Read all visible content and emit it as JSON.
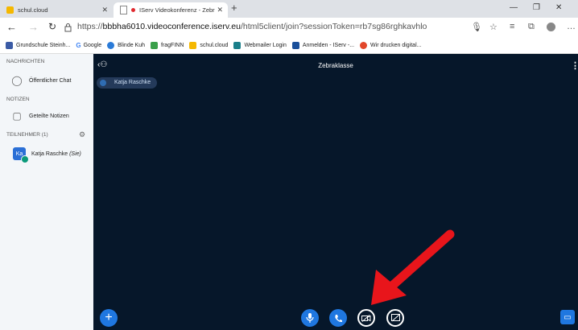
{
  "browser": {
    "tabs": [
      {
        "label": "schul.cloud",
        "active": false
      },
      {
        "label": "IServ Videokonferenz - Zebr",
        "active": true
      }
    ],
    "new_tab": "+",
    "url_scheme": "https://",
    "url_host": "bbbha6010.videoconference.iserv.eu",
    "url_path": "/html5client/join?sessionToken=rb7sg86rghkavhlo",
    "bookmarks": [
      {
        "label": "Grundschule Steinh...",
        "color": "#3b5ba5"
      },
      {
        "label": "Google",
        "color": "#4285f4"
      },
      {
        "label": "Blinde Kuh",
        "color": "#2b7bd8"
      },
      {
        "label": "fragFINN",
        "color": "#3aa04a"
      },
      {
        "label": "schul.cloud",
        "color": "#f5b800"
      },
      {
        "label": "Webmailer Login",
        "color": "#1a7f8a"
      },
      {
        "label": "Anmelden - IServ -...",
        "color": "#1a4f9a"
      },
      {
        "label": "Wir drucken digital...",
        "color": "#e2472a"
      }
    ]
  },
  "sidebar": {
    "messages_header": "NACHRICHTEN",
    "public_chat": "Öffentlicher Chat",
    "notes_header": "NOTIZEN",
    "shared_notes": "Geteilte Notizen",
    "participants_header": "TEILNEHMER (1)",
    "user_initials": "Ka",
    "user_name": "Katja Raschke",
    "user_suffix": "(Sie)"
  },
  "main": {
    "room_title": "Zebraklasse",
    "talker": "Katja Raschke"
  },
  "colors": {
    "accent": "#1f77e0",
    "stage": "#06172a",
    "arrow": "#e8151b"
  }
}
